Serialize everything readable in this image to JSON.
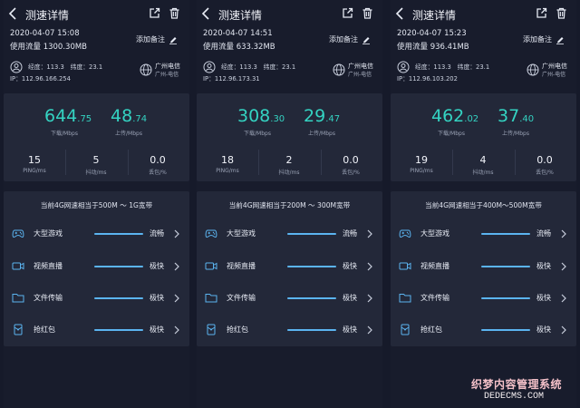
{
  "header": {
    "title": "测速详情",
    "note_label": "添加备注"
  },
  "panels": [
    {
      "datetime": "2020-04-07 15:08",
      "usage": "使用流量 1300.30MB",
      "coords": "经度：113.3　纬度：23.1",
      "ip": "IP：112.96.166.254",
      "isp": "广州电信",
      "isp_sub": "广州-电信",
      "download_int": "644",
      "download_dec": ".75",
      "upload_int": "48",
      "upload_dec": ".74",
      "ping": "15",
      "jitter": "5",
      "loss": "0.0",
      "summary": "当前4G网速相当于500M ～ 1G宽带",
      "services": [
        {
          "name": "大型游戏",
          "status": "流畅",
          "level": 1.0
        },
        {
          "name": "视频直播",
          "status": "极快",
          "level": 1.0
        },
        {
          "name": "文件传输",
          "status": "极快",
          "level": 1.0
        },
        {
          "name": "抢红包",
          "status": "极快",
          "level": 1.0
        }
      ]
    },
    {
      "datetime": "2020-04-07 14:51",
      "usage": "使用流量 633.32MB",
      "coords": "经度：113.3　纬度：23.1",
      "ip": "IP：112.96.173.31",
      "isp": "广州电信",
      "isp_sub": "广州-电信",
      "download_int": "308",
      "download_dec": ".30",
      "upload_int": "29",
      "upload_dec": ".47",
      "ping": "18",
      "jitter": "2",
      "loss": "0.0",
      "summary": "当前4G网速相当于200M ～ 300M宽带",
      "services": [
        {
          "name": "大型游戏",
          "status": "流畅",
          "level": 1.0
        },
        {
          "name": "视频直播",
          "status": "极快",
          "level": 1.0
        },
        {
          "name": "文件传输",
          "status": "极快",
          "level": 1.0
        },
        {
          "name": "抢红包",
          "status": "极快",
          "level": 1.0
        }
      ]
    },
    {
      "datetime": "2020-04-07 15:23",
      "usage": "使用流量 936.41MB",
      "coords": "经度：113.3　纬度：23.1",
      "ip": "IP：112.96.103.202",
      "isp": "广州电信",
      "isp_sub": "广州-电信",
      "download_int": "462",
      "download_dec": ".02",
      "upload_int": "37",
      "upload_dec": ".40",
      "ping": "19",
      "jitter": "4",
      "loss": "0.0",
      "summary": "当前4G网速相当于400M～500M宽带",
      "services": [
        {
          "name": "大型游戏",
          "status": "流畅",
          "level": 1.0
        },
        {
          "name": "视频直播",
          "status": "极快",
          "level": 1.0
        },
        {
          "name": "文件传输",
          "status": "极快",
          "level": 1.0
        },
        {
          "name": "抢红包",
          "status": "极快",
          "level": 1.0
        }
      ]
    }
  ],
  "labels": {
    "download": "下载/Mbps",
    "upload": "上传/Mbps",
    "ping": "PING/ms",
    "jitter": "抖动/ms",
    "loss": "丢包/%"
  },
  "icons": {
    "back": "chevron-left-icon",
    "share": "share-icon",
    "delete": "trash-icon",
    "pen": "pen-icon",
    "person": "user-circle-icon",
    "globe": "globe-icon",
    "game": "gamepad-icon",
    "video": "video-camera-icon",
    "file": "folder-icon",
    "redpacket": "red-envelope-icon"
  },
  "colors": {
    "accent": "#34d3c2",
    "bar": "#5bb4f0",
    "background": "#181c2c",
    "card": "#232839"
  },
  "watermark": {
    "line1": "织梦内容管理系统",
    "line2": "DEDECMS.COM"
  }
}
